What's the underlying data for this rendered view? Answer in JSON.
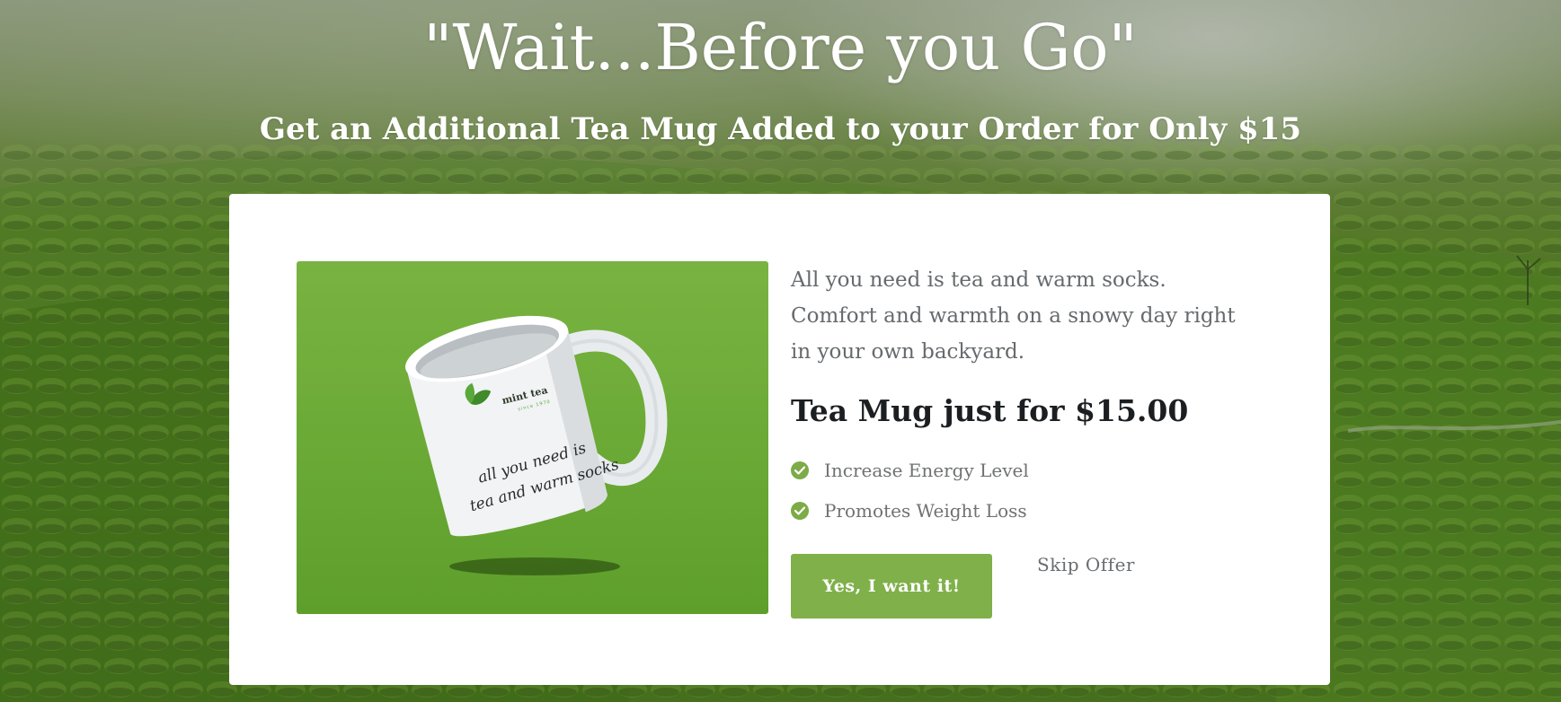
{
  "hero": {
    "headline": "\"Wait...Before you Go\"",
    "subheadline": "Get an Additional Tea Mug Added to your Order for Only $15"
  },
  "offer": {
    "image": {
      "brand": "mint tea",
      "brand_tagline": "since 1970",
      "mug_text_line1": "all you need is",
      "mug_text_line2": "tea and warm socks"
    },
    "description": "All you need is tea and warm socks. Comfort and warmth on a snowy day right in your own backyard.",
    "title": "Tea Mug just for $15.00",
    "benefits": [
      {
        "label": "Increase Energy Level",
        "icon": "check-circle-icon"
      },
      {
        "label": "Promotes Weight Loss",
        "icon": "check-circle-icon"
      }
    ],
    "accept_label": "Yes, I want it!",
    "skip_label": "Skip Offer"
  },
  "colors": {
    "accent": "#80b04a",
    "check": "#7cab47",
    "image_bg": "#6aa935"
  }
}
